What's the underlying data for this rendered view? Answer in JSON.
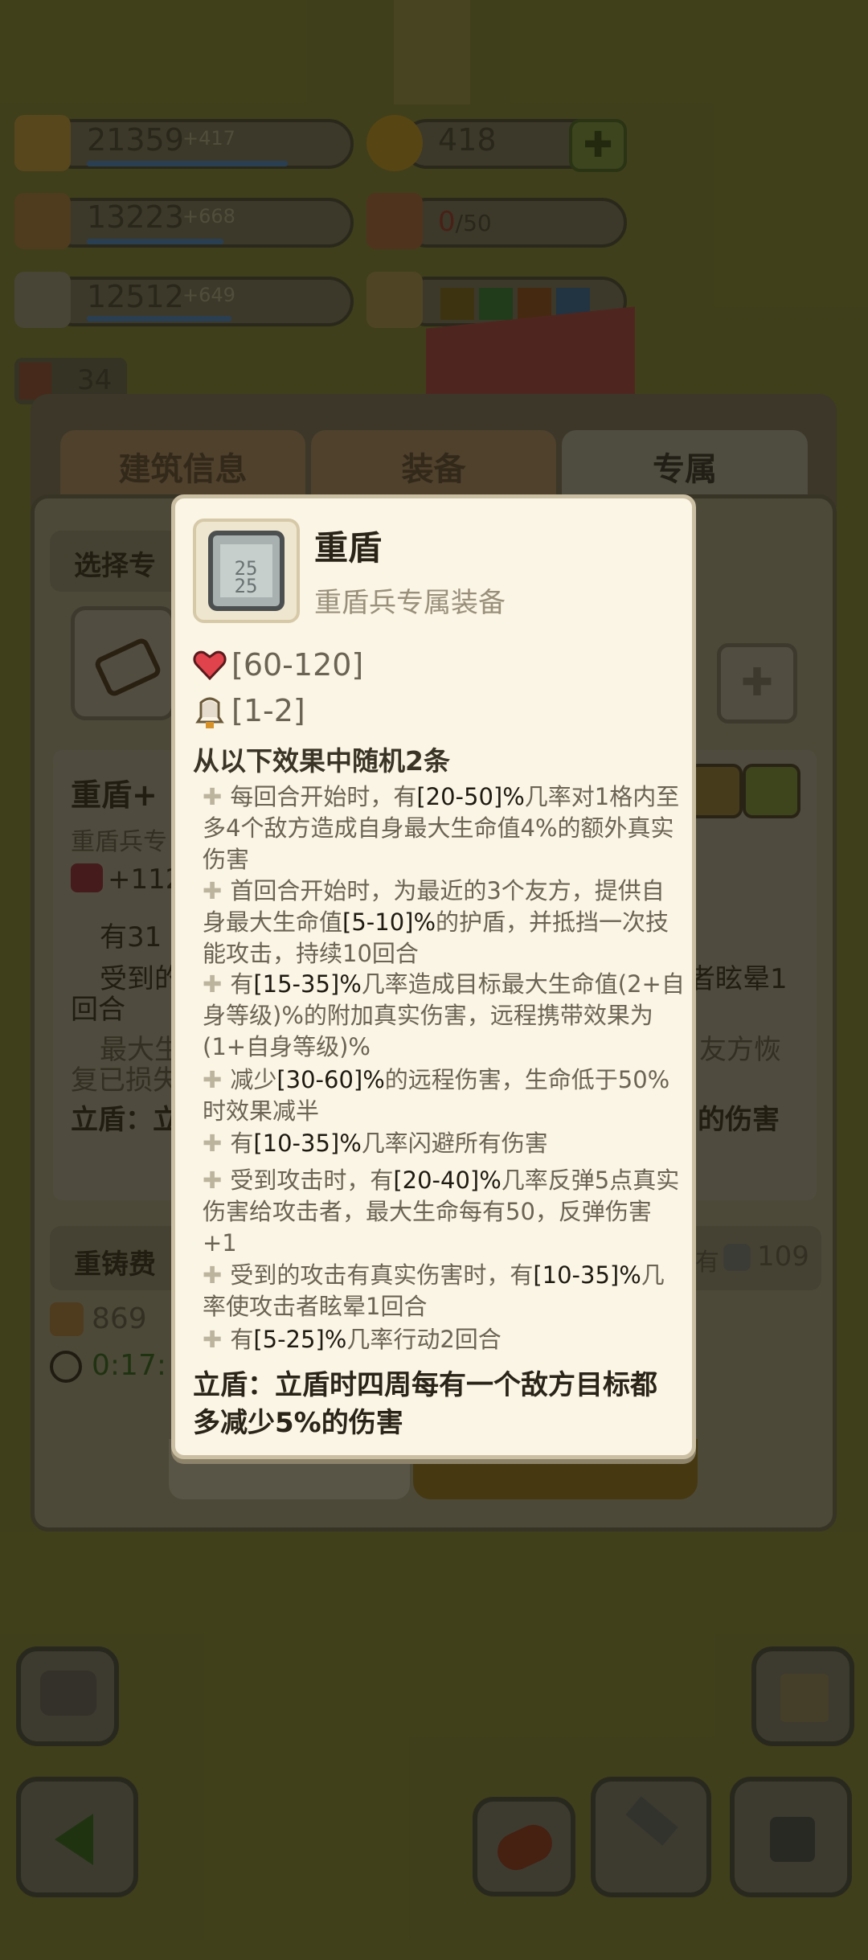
{
  "resources": {
    "paw": {
      "value": "21359",
      "inc": "+417"
    },
    "meat": {
      "value": "13223",
      "inc": "+668"
    },
    "stone": {
      "value": "12512",
      "inc": "+649"
    },
    "coin": {
      "value": "418"
    },
    "gift": {
      "current": "0",
      "max": "/50"
    },
    "book_count": "34"
  },
  "tabs": [
    "建筑信息",
    "装备",
    "专属"
  ],
  "panel": {
    "select_label": "选择专",
    "item_title": "重盾+",
    "item_sub": "重盾兵专",
    "hp_bonus": "+112",
    "line_a": "有31",
    "line_b": "受到的",
    "line_b_tail": "者眩晕1",
    "line_b2": "回合",
    "line_c": "最大生",
    "line_c_tail": "友方恢",
    "line_c2": "复已损失",
    "line_d": "立盾：立",
    "line_d_tail": "的伤害",
    "recast_label": "重铸费",
    "owned_label": "有",
    "owned_value": "109",
    "cost_value": "869",
    "timer": "0:17:"
  },
  "popup": {
    "title": "重盾",
    "subtitle": "重盾兵专属装备",
    "hp_range": "[60-120]",
    "dur_range": "[1-2]",
    "effects_header": "从以下效果中随机2条",
    "effects": [
      [
        "每回合开始时，有",
        "[20-50]%",
        "几率对1格内至多4个敌方造成自身最大生命值4%的额外真实伤害"
      ],
      [
        "首回合开始时，为最近的3个友方，提供自身最大生命值",
        "[5-10]%",
        "的护盾，并抵挡一次技能攻击，持续10回合"
      ],
      [
        "有",
        "[15-35]%",
        "几率造成目标最大生命值(2+自身等级)%的附加真实伤害，远程携带效果为(1+自身等级)%"
      ],
      [
        "减少",
        "[30-60]%",
        "的远程伤害，生命低于50%时效果减半"
      ],
      [
        "有",
        "[10-35]%",
        "几率闪避所有伤害"
      ],
      [
        "受到攻击时，有",
        "[20-40]%",
        "几率反弹5点真实伤害给攻击者，最大生命每有50，反弹伤害+1"
      ],
      [
        "受到的攻击有真实伤害时，有",
        "[10-35]%",
        "几率使攻击者眩晕1回合"
      ],
      [
        "有",
        "[5-25]%",
        "几率行动2回合"
      ]
    ],
    "footer": "立盾：立盾时四周每有一个敌方目标都多减少5%的伤害"
  },
  "colors": {
    "popup_bg": "#fbf5e6",
    "highlight_text": "#1f1a10",
    "muted_text": "#6b6354",
    "heart": "#e0434c"
  }
}
